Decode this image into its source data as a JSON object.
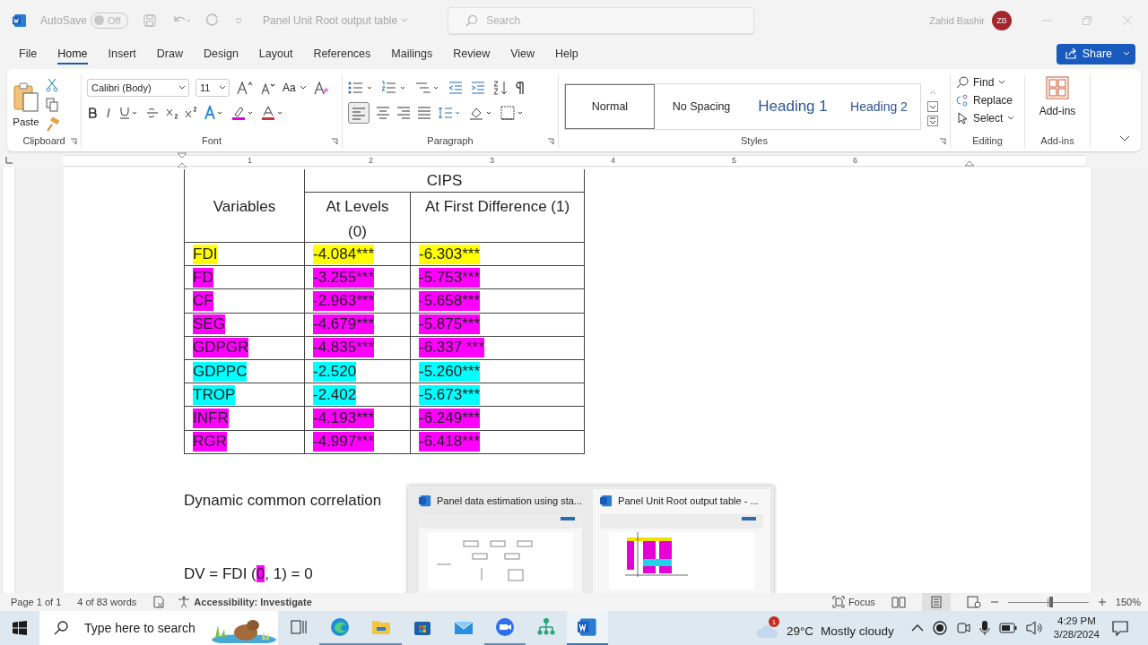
{
  "window": {
    "title": "Panel Unit Root output table",
    "autosave": {
      "label": "AutoSave",
      "state": "Off",
      "on": false
    },
    "search": {
      "placeholder": "Search"
    },
    "user": {
      "name": "Zahid Bashir",
      "initials": "ZB"
    }
  },
  "menu_tabs": [
    {
      "label": "File",
      "selected": false
    },
    {
      "label": "Home",
      "selected": true
    },
    {
      "label": "Insert",
      "selected": false
    },
    {
      "label": "Draw",
      "selected": false
    },
    {
      "label": "Design",
      "selected": false
    },
    {
      "label": "Layout",
      "selected": false
    },
    {
      "label": "References",
      "selected": false
    },
    {
      "label": "Mailings",
      "selected": false
    },
    {
      "label": "Review",
      "selected": false
    },
    {
      "label": "View",
      "selected": false
    },
    {
      "label": "Help",
      "selected": false
    }
  ],
  "share_button": "Share",
  "ribbon": {
    "clipboard": {
      "paste": "Paste",
      "label": "Clipboard"
    },
    "font": {
      "name": "Calibri (Body)",
      "size": "11",
      "case": "Aa",
      "label": "Font"
    },
    "paragraph": {
      "label": "Paragraph"
    },
    "styles": {
      "label": "Styles",
      "items": [
        {
          "label": "Normal",
          "selected": true
        },
        {
          "label": "No Spacing",
          "selected": false
        },
        {
          "label": "Heading 1",
          "selected": false
        },
        {
          "label": "Heading 2",
          "selected": false
        }
      ]
    },
    "editing": {
      "label": "Editing",
      "find": "Find",
      "replace": "Replace",
      "select": "Select"
    },
    "addins": {
      "button": "Add-ins",
      "label": "Add-ins"
    }
  },
  "ruler": {
    "numbers": [
      "1",
      "2",
      "3",
      "4",
      "5",
      "6"
    ]
  },
  "document": {
    "table": {
      "title": "CIPS",
      "columns": [
        "Variables",
        "At Levels (0)",
        "At First Difference (1)"
      ],
      "rows": [
        [
          {
            "text": "FDI",
            "color": "#ffff00"
          },
          {
            "text": "-4.084***",
            "color": "#ffff00"
          },
          {
            "text": "-6.303***",
            "color": "#ffff00"
          }
        ],
        [
          {
            "text": "FD",
            "color": "#ff00ff"
          },
          {
            "text": "-3.255***",
            "color": "#ff00ff"
          },
          {
            "text": "-5.753***",
            "color": "#ff00ff"
          }
        ],
        [
          {
            "text": "CF",
            "color": "#ff00ff"
          },
          {
            "text": "-2.963***",
            "color": "#ff00ff"
          },
          {
            "text": "-5.658***",
            "color": "#ff00ff"
          }
        ],
        [
          {
            "text": "SEG",
            "color": "#ff00ff"
          },
          {
            "text": "-4.679***",
            "color": "#ff00ff"
          },
          {
            "text": "-5.875***",
            "color": "#ff00ff"
          }
        ],
        [
          {
            "text": "GDPGR",
            "color": "#ff00ff"
          },
          {
            "text": "-4.835***",
            "color": "#ff00ff"
          },
          {
            "text": "-6.337 ***",
            "color": "#ff00ff"
          }
        ],
        [
          {
            "text": "GDPPC",
            "color": "#00ffff"
          },
          {
            "text": "-2.520",
            "color": "#00ffff"
          },
          {
            "text": "-5.260***",
            "color": "#00ffff"
          }
        ],
        [
          {
            "text": "TROP",
            "color": "#00ffff"
          },
          {
            "text": "-2.402",
            "color": "#00ffff"
          },
          {
            "text": "-5.673***",
            "color": "#00ffff"
          }
        ],
        [
          {
            "text": "INFR",
            "color": "#ff00ff"
          },
          {
            "text": "-4.193***",
            "color": "#ff00ff"
          },
          {
            "text": "-6.249***",
            "color": "#ff00ff"
          }
        ],
        [
          {
            "text": "RGR",
            "color": "#ff00ff"
          },
          {
            "text": "-4.997***",
            "color": "#ff00ff"
          },
          {
            "text": "-6.418***",
            "color": "#ff00ff"
          }
        ]
      ]
    },
    "paragraphs": [
      {
        "parts": [
          {
            "text": "Dynamic common correlation"
          }
        ]
      },
      {
        "parts": [
          {
            "text": "DV = FDI ("
          },
          {
            "text": "0",
            "color": "#ff00ff"
          },
          {
            "text": ", 1) = 0"
          }
        ]
      }
    ]
  },
  "status_bar": {
    "page": "Page 1 of 1",
    "words": "4 of 83 words",
    "accessibility": "Accessibility: Investigate",
    "focus": "Focus",
    "zoom": {
      "level": 0.54,
      "reading": "150%"
    }
  },
  "taskbar_preview": [
    {
      "title": "Panel data estimation using sta...",
      "selected": false
    },
    {
      "title": "Panel Unit Root output table - ...",
      "selected": true
    }
  ],
  "taskbar": {
    "search": {
      "placeholder": "Type here to search"
    },
    "apps": [
      {
        "kind": "taskview",
        "running": false,
        "selected": false
      },
      {
        "kind": "edge",
        "running": true,
        "selected": false
      },
      {
        "kind": "folder",
        "running": true,
        "selected": false
      },
      {
        "kind": "store",
        "running": false,
        "selected": false
      },
      {
        "kind": "mail",
        "running": false,
        "selected": false
      },
      {
        "kind": "zoom",
        "running": true,
        "selected": false
      },
      {
        "kind": "network",
        "running": false,
        "selected": false
      },
      {
        "kind": "word",
        "running": true,
        "selected": true
      }
    ],
    "weather": {
      "badge": "1",
      "temperature": "29°C",
      "condition": "Mostly cloudy"
    },
    "time": "4:29 PM",
    "date": "3/28/2024"
  }
}
